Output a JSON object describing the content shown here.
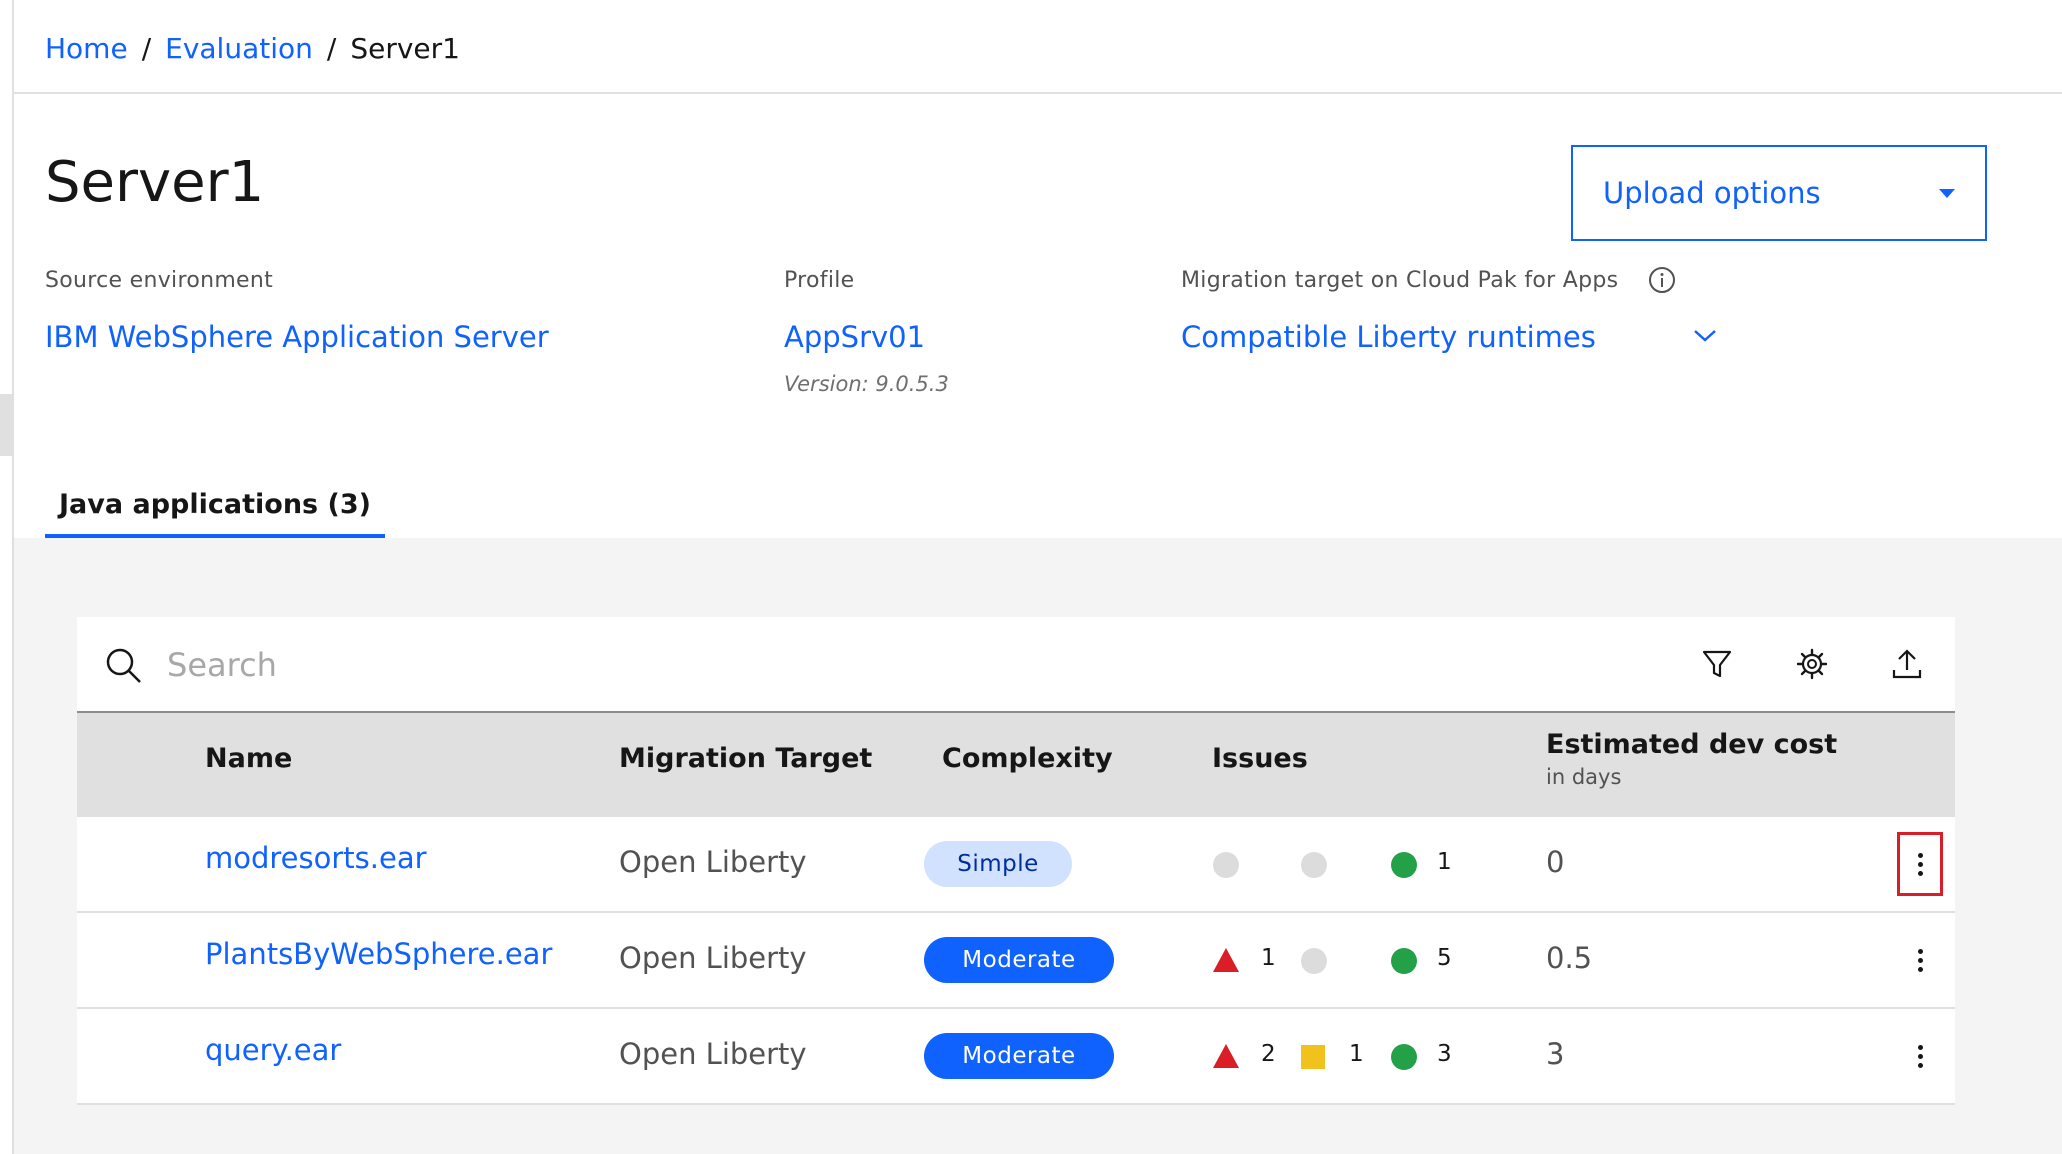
{
  "breadcrumb": {
    "home": "Home",
    "evaluation": "Evaluation",
    "current": "Server1",
    "separator": "/"
  },
  "page": {
    "title": "Server1"
  },
  "upload": {
    "label": "Upload options"
  },
  "meta": {
    "source_label": "Source environment",
    "source_value": "IBM WebSphere Application Server",
    "profile_label": "Profile",
    "profile_value": "AppSrv01",
    "profile_version": "Version: 9.0.5.3",
    "target_label": "Migration target on Cloud Pak for Apps",
    "target_value": "Compatible Liberty runtimes"
  },
  "tabs": [
    {
      "label": "Java applications (3)",
      "active": true
    }
  ],
  "search": {
    "placeholder": "Search"
  },
  "toolbar_icons": [
    "filter-icon",
    "settings-icon",
    "export-icon"
  ],
  "table": {
    "headers": {
      "name": "Name",
      "target": "Migration Target",
      "complexity": "Complexity",
      "issues": "Issues",
      "cost": "Estimated dev cost",
      "cost_sub": "in days"
    },
    "rows": [
      {
        "name": "modresorts.ear",
        "target": "Open Liberty",
        "complexity": "Simple",
        "issues": {
          "critical": "",
          "warning": "",
          "info": "1"
        },
        "cost": "0"
      },
      {
        "name": "PlantsByWebSphere.ear",
        "target": "Open Liberty",
        "complexity": "Moderate",
        "issues": {
          "critical": "1",
          "warning": "",
          "info": "5"
        },
        "cost": "0.5"
      },
      {
        "name": "query.ear",
        "target": "Open Liberty",
        "complexity": "Moderate",
        "issues": {
          "critical": "2",
          "warning": "1",
          "info": "3"
        },
        "cost": "3"
      }
    ]
  },
  "colors": {
    "accent": "#0f62fe",
    "critical": "#da1e28",
    "warning": "#f1c21b",
    "info": "#24a148",
    "empty": "#dcdcdc",
    "highlight": "#da1e28"
  }
}
